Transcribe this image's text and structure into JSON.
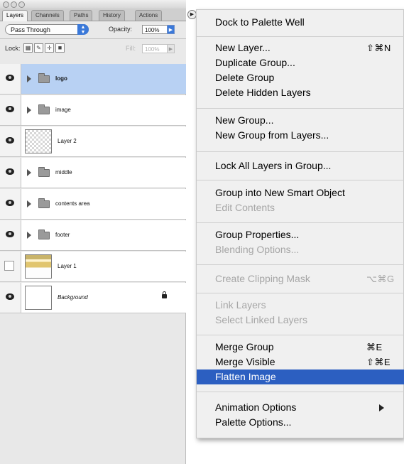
{
  "palette": {
    "tabs": [
      "Layers",
      "Channels",
      "Paths",
      "History",
      "Actions"
    ],
    "blend_mode": "Pass Through",
    "opacity_label": "Opacity:",
    "opacity_value": "100%",
    "lock_label": "Lock:",
    "fill_label": "Fill:",
    "fill_value": "100%",
    "layers": [
      {
        "name": "logo",
        "kind": "group",
        "visible": true,
        "selected": true
      },
      {
        "name": "image",
        "kind": "group",
        "visible": true,
        "selected": false
      },
      {
        "name": "Layer 2",
        "kind": "layer",
        "visible": true,
        "selected": false
      },
      {
        "name": "middle",
        "kind": "group",
        "visible": true,
        "selected": false
      },
      {
        "name": "contents area",
        "kind": "group",
        "visible": true,
        "selected": false
      },
      {
        "name": "footer",
        "kind": "group",
        "visible": true,
        "selected": false
      },
      {
        "name": "Layer 1",
        "kind": "layer",
        "visible": false,
        "selected": false
      },
      {
        "name": "Background",
        "kind": "background",
        "visible": true,
        "selected": false,
        "locked": true
      }
    ]
  },
  "menu": {
    "items": [
      {
        "label": "Dock to Palette Well",
        "shortcut": "",
        "disabled": false
      },
      {
        "label": "New Layer...",
        "shortcut": "⇧⌘N",
        "disabled": false
      },
      {
        "label": "Duplicate Group...",
        "shortcut": "",
        "disabled": false
      },
      {
        "label": "Delete Group",
        "shortcut": "",
        "disabled": false
      },
      {
        "label": "Delete Hidden Layers",
        "shortcut": "",
        "disabled": false
      },
      {
        "label": "New Group...",
        "shortcut": "",
        "disabled": false
      },
      {
        "label": "New Group from Layers...",
        "shortcut": "",
        "disabled": false
      },
      {
        "label": "Lock All Layers in Group...",
        "shortcut": "",
        "disabled": false
      },
      {
        "label": "Group into New Smart Object",
        "shortcut": "",
        "disabled": false
      },
      {
        "label": "Edit Contents",
        "shortcut": "",
        "disabled": true
      },
      {
        "label": "Group Properties...",
        "shortcut": "",
        "disabled": false
      },
      {
        "label": "Blending Options...",
        "shortcut": "",
        "disabled": true
      },
      {
        "label": "Create Clipping Mask",
        "shortcut": "⌥⌘G",
        "disabled": true
      },
      {
        "label": "Link Layers",
        "shortcut": "",
        "disabled": true
      },
      {
        "label": "Select Linked Layers",
        "shortcut": "",
        "disabled": true
      },
      {
        "label": "Merge Group",
        "shortcut": "⌘E",
        "disabled": false
      },
      {
        "label": "Merge Visible",
        "shortcut": "⇧⌘E",
        "disabled": false
      },
      {
        "label": "Flatten Image",
        "shortcut": "",
        "disabled": false,
        "highlighted": true
      },
      {
        "label": "Animation Options",
        "shortcut": "",
        "disabled": false,
        "submenu": true
      },
      {
        "label": "Palette Options...",
        "shortcut": "",
        "disabled": false
      }
    ]
  }
}
